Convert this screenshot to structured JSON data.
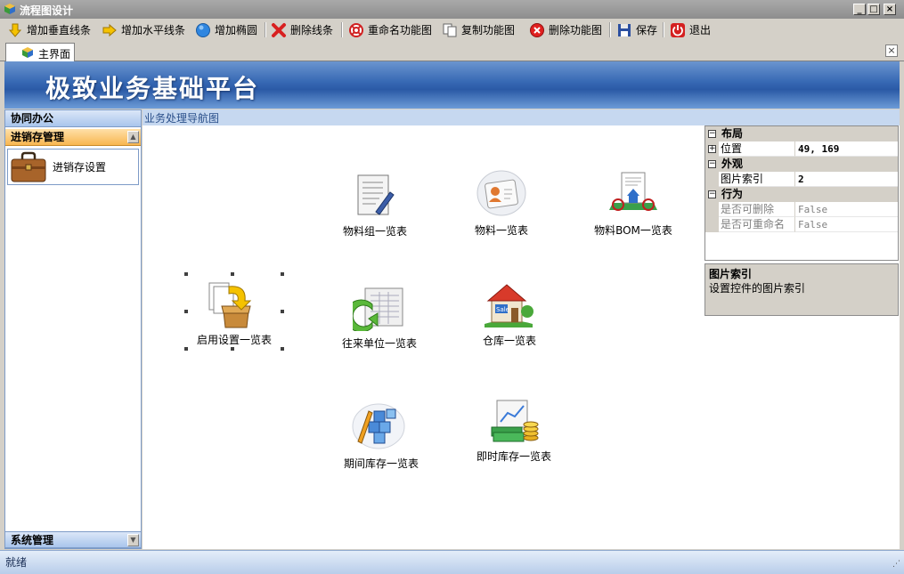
{
  "window": {
    "title": "流程图设计"
  },
  "toolbar": [
    {
      "label": "增加垂直线条",
      "icon": "arrow-down-icon"
    },
    {
      "label": "增加水平线条",
      "icon": "arrow-right-icon"
    },
    {
      "label": "增加椭圆",
      "icon": "ellipse-icon"
    },
    {
      "label": "删除线条",
      "icon": "delete-x-icon"
    },
    {
      "label": "重命名功能图",
      "icon": "lifebuoy-icon"
    },
    {
      "label": "复制功能图",
      "icon": "copy-icon"
    },
    {
      "label": "删除功能图",
      "icon": "delete-circle-icon"
    },
    {
      "label": "保存",
      "icon": "save-disk-icon"
    },
    {
      "label": "退出",
      "icon": "power-icon"
    }
  ],
  "tab": {
    "label": "主界面"
  },
  "banner": {
    "title": "极致业务基础平台"
  },
  "sidebar": {
    "groups": [
      {
        "label": "协同办公"
      },
      {
        "label": "进销存管理"
      },
      {
        "label": "系统管理"
      }
    ],
    "items": [
      {
        "label": "进销存设置",
        "icon": "briefcase-icon"
      }
    ]
  },
  "main": {
    "header": "业务处理导航图",
    "nodes": [
      {
        "label": "物料组一览表",
        "icon": "document-pen-icon"
      },
      {
        "label": "物料一览表",
        "icon": "contact-card-icon"
      },
      {
        "label": "物料BOM一览表",
        "icon": "house-document-icon"
      },
      {
        "label": "启用设置一览表",
        "icon": "box-arrow-icon"
      },
      {
        "label": "往来单位一览表",
        "icon": "spreadsheet-arrow-icon"
      },
      {
        "label": "仓库一览表",
        "icon": "warehouse-icon"
      },
      {
        "label": "期间库存一览表",
        "icon": "blocks-pencil-icon"
      },
      {
        "label": "即时库存一览表",
        "icon": "chart-coins-icon"
      }
    ]
  },
  "properties": {
    "categories": [
      {
        "name": "布局",
        "rows": [
          {
            "name": "位置",
            "value": "49, 169",
            "expandable": true
          }
        ]
      },
      {
        "name": "外观",
        "rows": [
          {
            "name": "图片索引",
            "value": "2"
          }
        ]
      },
      {
        "name": "行为",
        "rows": [
          {
            "name": "是否可删除",
            "value": "False"
          },
          {
            "name": "是否可重命名",
            "value": "False"
          }
        ]
      }
    ],
    "description": {
      "title": "图片索引",
      "text": "设置控件的图片索引"
    }
  },
  "status": {
    "text": "就绪"
  }
}
